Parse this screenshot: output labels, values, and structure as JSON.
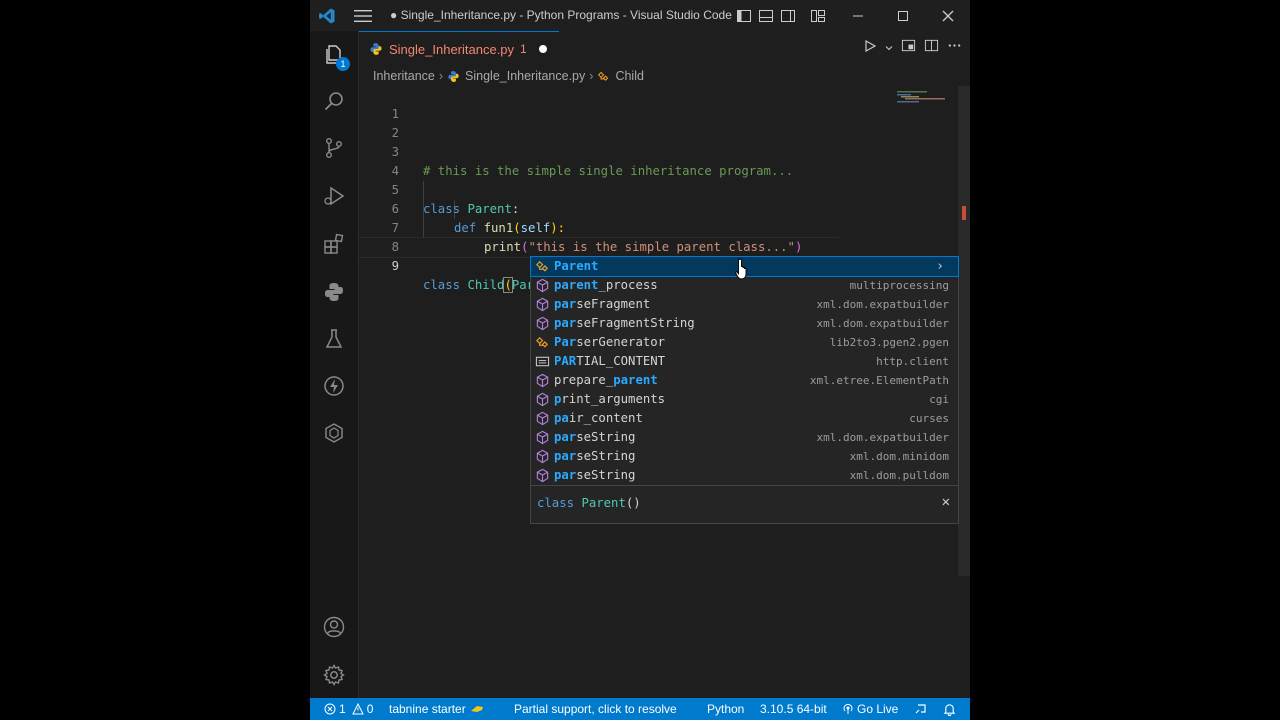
{
  "window": {
    "title": "● Single_Inheritance.py - Python Programs - Visual Studio Code"
  },
  "activity_bar": {
    "explorer_badge": "1",
    "items": [
      "explorer-icon",
      "search-icon",
      "source-control-icon",
      "run-debug-icon",
      "extensions-icon",
      "python-icon",
      "testing-icon",
      "live-share-icon",
      "remote-icon"
    ]
  },
  "tab": {
    "filename": "Single_Inheritance.py",
    "problems": "1"
  },
  "breadcrumb": {
    "folder": "Inheritance",
    "file": "Single_Inheritance.py",
    "symbol": "Child"
  },
  "editor": {
    "line_numbers": [
      "1",
      "2",
      "3",
      "4",
      "5",
      "6",
      "7",
      "8",
      "9"
    ],
    "lines": {
      "l3_comment": "# this is the simple single inheritance program...",
      "l5_kw": "class",
      "l5_name": "Parent",
      "l5_colon": ":",
      "l6_kw": "def",
      "l6_fn": "fun1",
      "l6_open": "(",
      "l6_param": "self",
      "l6_close": "):",
      "l7_fn": "print",
      "l7_open": "(",
      "l7_str": "\"this is the simple parent class...\"",
      "l7_close": ")",
      "l9_kw": "class",
      "l9_name": "Child",
      "l9_open": "(",
      "l9_base": "Parent",
      "l9_close": ")"
    }
  },
  "suggestions": [
    {
      "pre": "",
      "hl": "Parent",
      "post": "",
      "detail": "",
      "kind": "class",
      "selected": true
    },
    {
      "pre": "",
      "hl": "parent",
      "post": "_process",
      "detail": "multiprocessing",
      "kind": "module"
    },
    {
      "pre": "",
      "hl": "par",
      "post": "seFragment",
      "detail": "xml.dom.expatbuilder",
      "kind": "module"
    },
    {
      "pre": "",
      "hl": "par",
      "post": "seFragmentString",
      "detail": "xml.dom.expatbuilder",
      "kind": "module"
    },
    {
      "pre": "",
      "hl": "Par",
      "post": "serGenerator",
      "detail": "lib2to3.pgen2.pgen",
      "kind": "class"
    },
    {
      "pre": "",
      "hl": "PAR",
      "post": "TIAL_CONTENT",
      "detail": "http.client",
      "kind": "constant"
    },
    {
      "pre": "prepare_",
      "hl": "parent",
      "post": "",
      "detail": "xml.etree.ElementPath",
      "kind": "module"
    },
    {
      "pre": "",
      "hl": "p",
      "post": "rint_arguments",
      "detail": "cgi",
      "kind": "module"
    },
    {
      "pre": "",
      "hl": "pa",
      "post": "ir_content",
      "detail": "curses",
      "kind": "module"
    },
    {
      "pre": "",
      "hl": "par",
      "post": "seString",
      "detail": "xml.dom.expatbuilder",
      "kind": "module"
    },
    {
      "pre": "",
      "hl": "par",
      "post": "seString",
      "detail": "xml.dom.minidom",
      "kind": "module"
    },
    {
      "pre": "",
      "hl": "par",
      "post": "seString",
      "detail": "xml.dom.pulldom",
      "kind": "module"
    }
  ],
  "suggest_doc": {
    "kw": "class",
    "name": "Parent",
    "parens": "()"
  },
  "status_bar": {
    "errors": "1",
    "warnings": "0",
    "tabnine": "tabnine starter",
    "partial_support": "Partial support, click to resolve",
    "language": "Python",
    "interpreter": "3.10.5 64-bit",
    "go_live": "Go Live"
  },
  "colors": {
    "status_bar": "#007acc",
    "accent": "#0078d4",
    "error_tab": "#f48771"
  }
}
